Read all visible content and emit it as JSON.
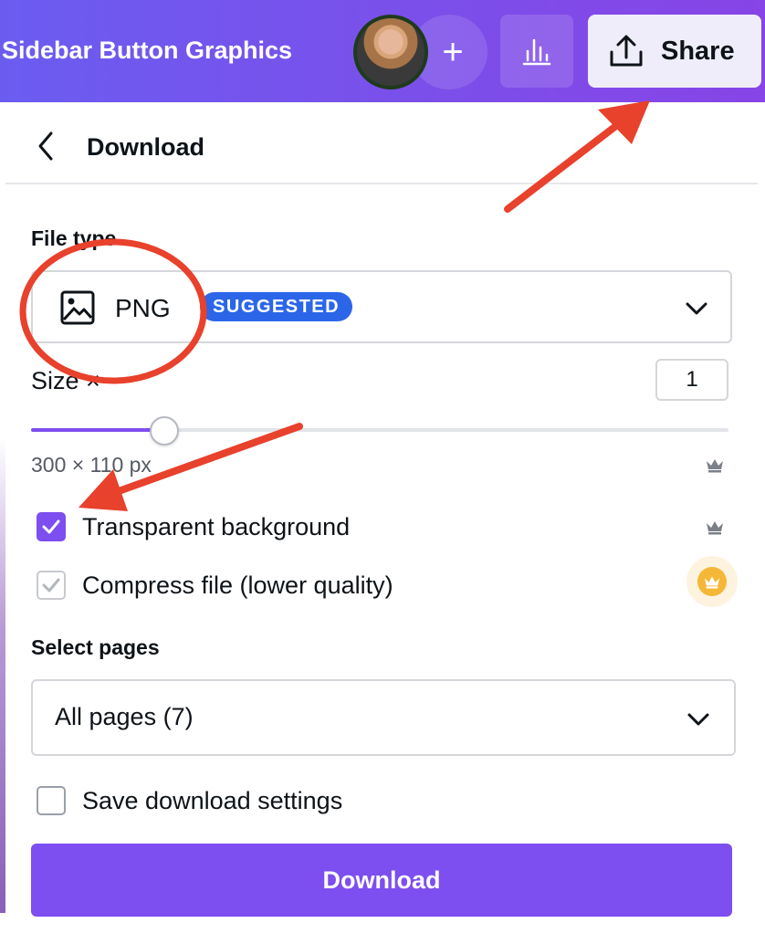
{
  "topbar": {
    "doc_title": "Sidebar Button Graphics",
    "add_label": "+",
    "share_label": "Share"
  },
  "panel": {
    "title": "Download",
    "file_type": {
      "label": "File type",
      "value": "PNG",
      "badge": "SUGGESTED"
    },
    "size": {
      "label": "Size ×",
      "value": "1",
      "slider_fraction": 0.19,
      "dimensions": "300 × 110 px"
    },
    "options": [
      {
        "label": "Transparent background",
        "checked": true
      },
      {
        "label": "Compress file (lower quality)",
        "checked": true,
        "disabled": true
      }
    ],
    "select_pages": {
      "label": "Select pages",
      "value": "All pages (7)"
    },
    "save_settings": {
      "label": "Save download settings",
      "checked": false
    },
    "download_button": "Download"
  },
  "colors": {
    "accent": "#7d4ef0",
    "badge": "#2b66e8",
    "annotation": "#e8412c",
    "pro": "#f5b738"
  }
}
